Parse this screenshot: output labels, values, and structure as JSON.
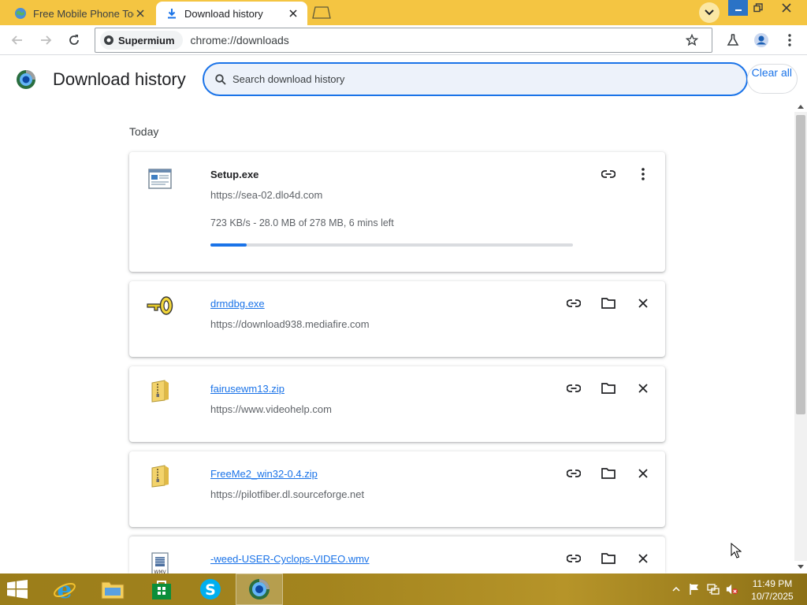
{
  "browser": {
    "tabs": [
      {
        "title": "Free Mobile Phone Tools",
        "favicon": "globe-favicon-icon",
        "active": false
      },
      {
        "title": "Download history",
        "favicon": "download-icon",
        "active": true
      }
    ],
    "omnibox": {
      "chip_label": "Supermium",
      "url": "chrome://downloads"
    },
    "accent": "#1a73e8",
    "tabstrip_color": "#f4c542"
  },
  "page": {
    "title": "Download history",
    "search_placeholder": "Search download history",
    "clear_all": "Clear all",
    "section_today": "Today"
  },
  "downloads": [
    {
      "name": "Setup.exe",
      "url": "https://sea-02.dlo4d.com",
      "status": "723 KB/s - 28.0 MB of 278 MB, 6 mins left",
      "progress": 0.1,
      "in_progress": true,
      "icon": "installer-file-icon"
    },
    {
      "name": "drmdbg.exe",
      "url": "https://download938.mediafire.com",
      "in_progress": false,
      "icon": "key-file-icon"
    },
    {
      "name": "fairusewm13.zip",
      "url": "https://www.videohelp.com",
      "in_progress": false,
      "icon": "zip-folder-icon"
    },
    {
      "name": "FreeMe2_win32-0.4.zip",
      "url": "https://pilotfiber.dl.sourceforge.net",
      "in_progress": false,
      "icon": "zip-folder-icon"
    },
    {
      "name": "-weed-USER-Cyclops-VIDEO.wmv",
      "url": "",
      "in_progress": false,
      "icon": "video-file-icon"
    }
  ],
  "taskbar": {
    "apps": [
      "internet-explorer-icon",
      "file-explorer-icon",
      "store-icon",
      "skype-icon",
      "supermium-icon"
    ],
    "time": "11:49 PM",
    "date": "10/7/2025"
  }
}
